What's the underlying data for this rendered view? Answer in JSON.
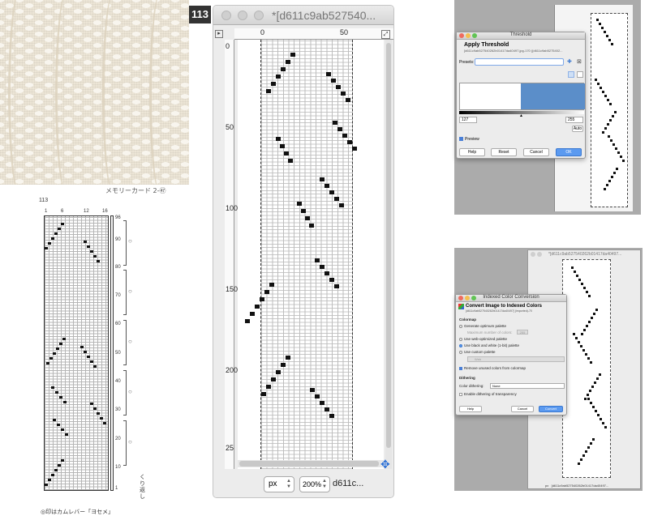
{
  "photo": {
    "caption": "メモリーカード 2-㊼"
  },
  "printed_chart": {
    "number": "113",
    "col_labels": [
      "1",
      "6",
      "12",
      "16"
    ],
    "row_labels": [
      "96",
      "90",
      "80",
      "70",
      "60",
      "50",
      "40",
      "30",
      "20",
      "10",
      "1"
    ],
    "side_note": "くり返し",
    "footnote": "◎印はカムレバー「ヨセメ」"
  },
  "badge": "113",
  "main_window": {
    "title": "*[d611c9ab527540...",
    "ruler_top_labels": [
      "0",
      "50"
    ],
    "ruler_left_labels": [
      "0",
      "50",
      "100",
      "150",
      "200",
      "25"
    ],
    "unit": "px",
    "zoom": "200%",
    "status_title": "d611c..."
  },
  "threshold_dialog": {
    "title": "Threshold",
    "heading": "Apply Threshold",
    "subheading": "[d611c9ab527540262b01417da40497.jpg-170 ([d611c9ab5275402...",
    "presets_label": "Presets:",
    "low_value": "127",
    "high_value": "255",
    "auto_label": "Auto",
    "preview_label": "Preview",
    "buttons": {
      "help": "Help",
      "reset": "Reset",
      "cancel": "Cancel",
      "ok": "OK"
    }
  },
  "indexed_dialog": {
    "title": "Indexed Color Conversion",
    "heading": "Convert Image to Indexed Colors",
    "subheading": "[d611c9ab527540262b01417da40497] (imported)-70",
    "image_window_title": "*[d611c9ab527540262b01417da40497...",
    "colormap_label": "Colormap",
    "options": [
      "Generate optimum palette",
      "Maximum number of colors:",
      "Use web-optimized palette",
      "Use black and white (1-bit) palette",
      "Use custom palette",
      "Remove unused colors from colormap"
    ],
    "max_colors": "255",
    "custom_palette": "Web",
    "dithering_label": "Dithering",
    "color_dithering_label": "Color dithering:",
    "color_dithering_value": "None",
    "transparency_option": "Enable dithering of transparency",
    "buttons": {
      "help": "Help",
      "cancel": "Cancel",
      "convert": "Convert"
    },
    "status_unit": "px",
    "status_text": "[d611c9ab527540262b01417da40497..."
  }
}
